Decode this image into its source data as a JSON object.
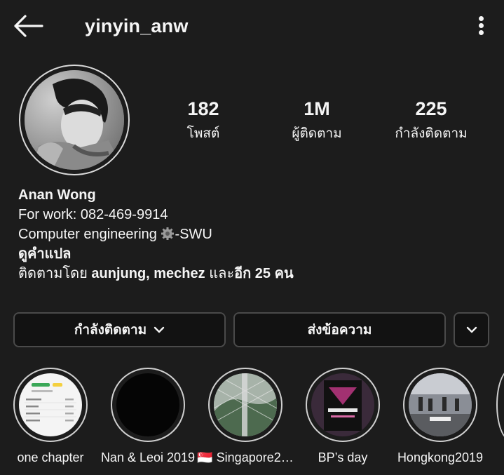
{
  "header": {
    "username": "yinyin_anw"
  },
  "stats": [
    {
      "value": "182",
      "label": "โพสต์"
    },
    {
      "value": "1M",
      "label": "ผู้ติดตาม"
    },
    {
      "value": "225",
      "label": "กำลังติดตาม"
    }
  ],
  "bio": {
    "name": "Anan Wong",
    "line1": "For work: 082-469-9914",
    "line2_pre": "Computer engineering ",
    "line2_post": "-SWU",
    "translate": "ดูคำแปล",
    "followed_pre": "ติดตามโดย ",
    "followed_users": "aunjung, mechez",
    "followed_mid": " และ",
    "followed_more": "อีก 25 คน"
  },
  "buttons": {
    "following": "กำลังติดตาม",
    "message": "ส่งข้อความ"
  },
  "highlights": [
    {
      "label": "one chapter"
    },
    {
      "label": "Nan & Leoi 2019"
    },
    {
      "label": "🇸🇬 Singapore2…"
    },
    {
      "label": "BP’s day"
    },
    {
      "label": "Hongkong2019"
    }
  ]
}
